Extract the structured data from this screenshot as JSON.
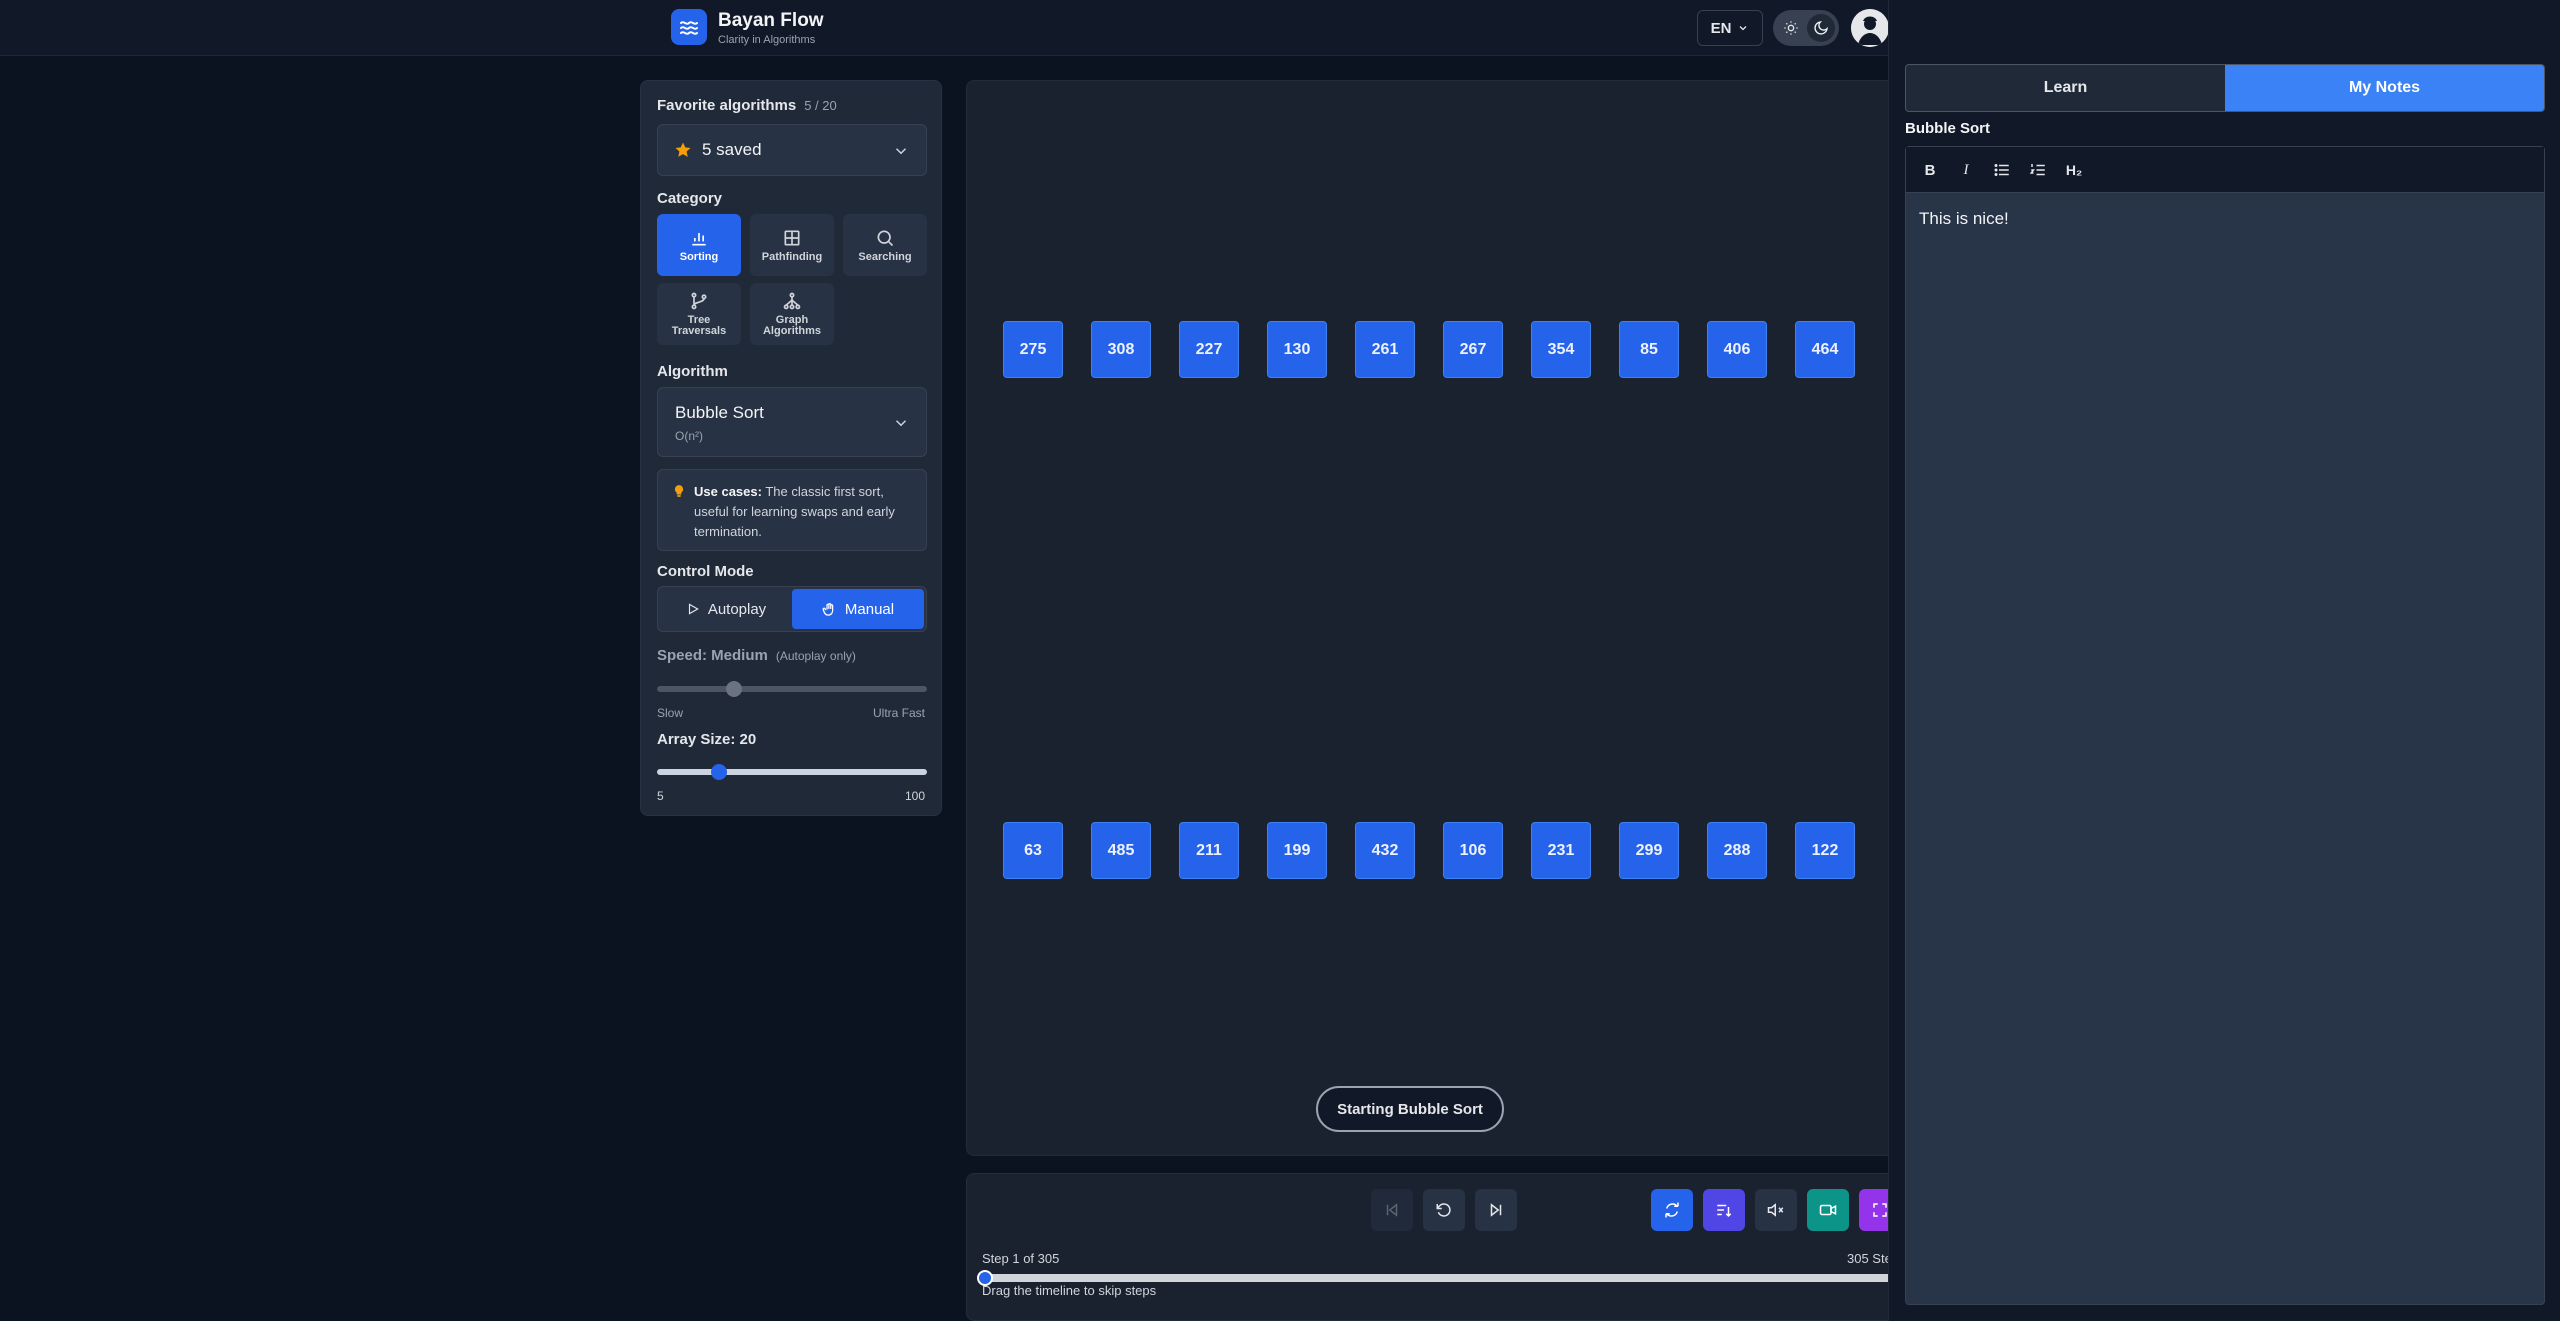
{
  "app": {
    "name": "Bayan Flow",
    "tagline": "Clarity in Algorithms"
  },
  "header": {
    "language": "EN"
  },
  "favorites": {
    "label": "Favorite algorithms",
    "count": "5 / 20",
    "selected": "5 saved"
  },
  "category": {
    "label": "Category",
    "items": [
      {
        "label": "Sorting",
        "icon": "bar-chart-icon",
        "active": true
      },
      {
        "label": "Pathfinding",
        "icon": "grid-icon",
        "active": false
      },
      {
        "label": "Searching",
        "icon": "search-icon",
        "active": false
      },
      {
        "label": "Tree Traversals",
        "icon": "git-branch-icon",
        "active": false
      },
      {
        "label": "Graph Algorithms",
        "icon": "network-icon",
        "active": false
      }
    ]
  },
  "algorithm": {
    "label": "Algorithm",
    "name": "Bubble Sort",
    "complexity": "O(n²)"
  },
  "use_cases": {
    "title": "Use cases:",
    "text": "The classic first sort, useful for learning swaps and early termination."
  },
  "control_mode": {
    "label": "Control Mode",
    "autoplay": "Autoplay",
    "manual": "Manual",
    "selected": "Manual"
  },
  "speed": {
    "label": "Speed: Medium",
    "note": "(Autoplay only)",
    "min_label": "Slow",
    "max_label": "Ultra Fast",
    "fraction": 0.27
  },
  "array_size": {
    "label": "Array Size: 20",
    "min": "5",
    "max": "100",
    "value": 20,
    "range": [
      5,
      100
    ]
  },
  "array": {
    "row1": [
      "275",
      "308",
      "227",
      "130",
      "261",
      "267",
      "354",
      "85",
      "406",
      "464"
    ],
    "row2": [
      "63",
      "485",
      "211",
      "199",
      "432",
      "106",
      "231",
      "299",
      "288",
      "122"
    ]
  },
  "status": "Starting Bubble Sort",
  "playback": {
    "step_text": "Step 1 of 305",
    "total_text": "305 Ste",
    "hint": "Drag the timeline to skip steps",
    "current_step": 1,
    "total_steps": 305
  },
  "notes": {
    "tabs": [
      "Learn",
      "My Notes"
    ],
    "active_tab": "My Notes",
    "title": "Bubble Sort",
    "toolbar": [
      "B",
      "I",
      "bullet-list-icon",
      "ordered-list-icon",
      "H₂"
    ],
    "content": "This is nice!"
  },
  "colors": {
    "accent": "#2563eb",
    "background": "#0b1220",
    "panel": "#1f2937",
    "favorite_star": "#f59e0b"
  }
}
